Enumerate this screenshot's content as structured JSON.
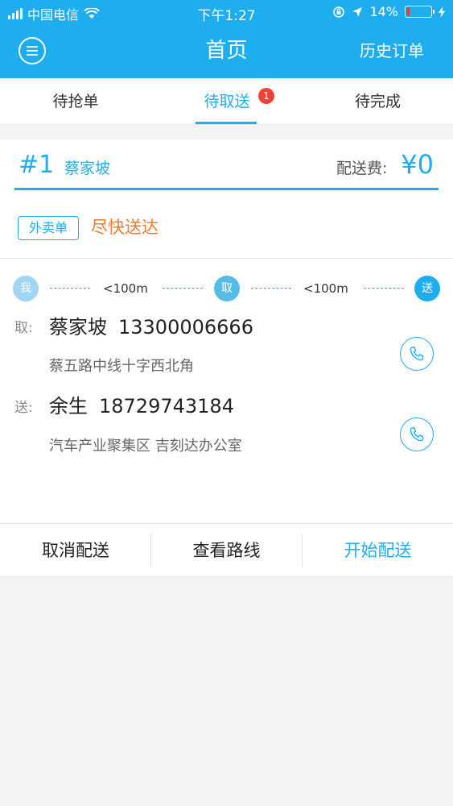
{
  "status_bar": {
    "carrier": "中国电信",
    "time": "下午1:27",
    "battery": "14%",
    "battery_level": 0.14
  },
  "nav": {
    "title": "首页",
    "right_label": "历史订单",
    "menu_icon": "menu-icon"
  },
  "tabs": [
    {
      "label": "待抢单"
    },
    {
      "label": "待取送",
      "badge": "1",
      "active": true
    },
    {
      "label": "待完成"
    }
  ],
  "order": {
    "number": "#1",
    "name": "蔡家坡",
    "fee_label": "配送费:",
    "fee_value": "¥0",
    "tag": "外卖单",
    "urgency": "尽快送达",
    "route": {
      "me": "我",
      "pickup": "取",
      "deliver": "送",
      "distance_1": "<100m",
      "distance_2": "<100m"
    },
    "pickup": {
      "label": "取:",
      "name": "蔡家坡",
      "phone": "13300006666",
      "address": "蔡五路中线十字西北角"
    },
    "delivery": {
      "label": "送:",
      "name": "余生",
      "phone": "18729743184",
      "address": "汽车产业聚集区 吉刻达办公室"
    }
  },
  "actions": {
    "cancel": "取消配送",
    "route": "查看路线",
    "start": "开始配送"
  },
  "colors": {
    "accent": "#1eaef0",
    "urgency": "#f07a30",
    "badge": "#f44336"
  }
}
